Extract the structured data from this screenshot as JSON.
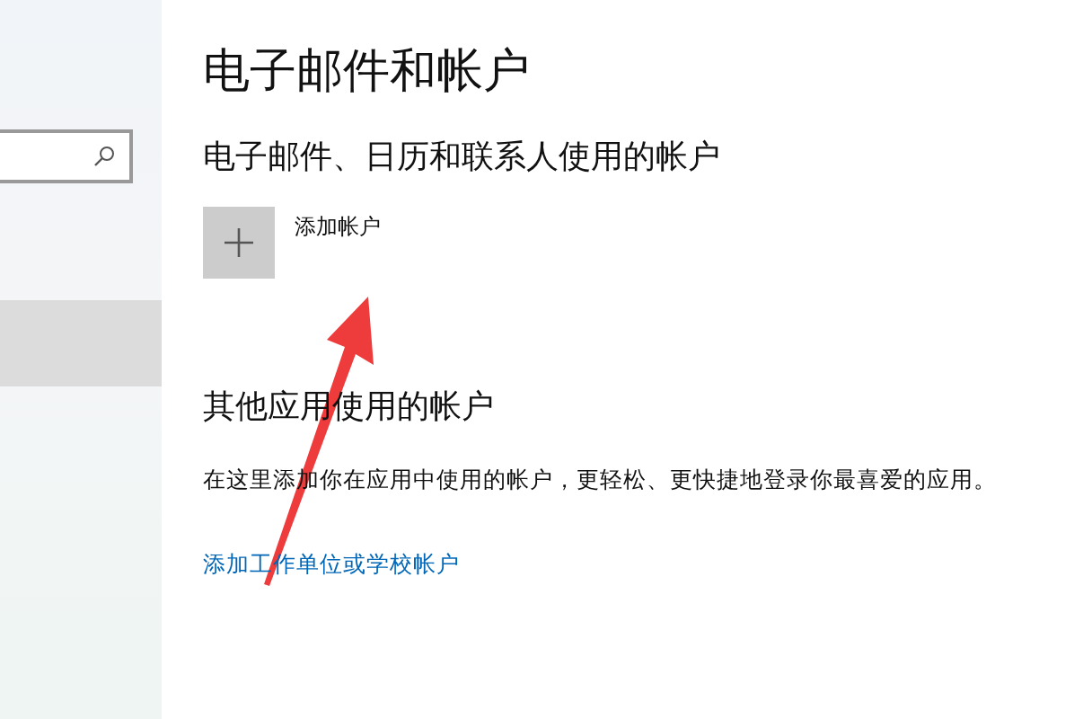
{
  "sidebar": {
    "items": [
      {
        "selected": true
      }
    ]
  },
  "title": "电子邮件和帐户",
  "sections": [
    {
      "heading": "电子邮件、日历和联系人使用的帐户",
      "add_button": {
        "label": "添加帐户"
      }
    },
    {
      "heading": "其他应用使用的帐户",
      "description": "在这里添加你在应用中使用的帐户，更轻松、更快捷地登录你最喜爱的应用。",
      "link": "添加工作单位或学校帐户"
    }
  ]
}
